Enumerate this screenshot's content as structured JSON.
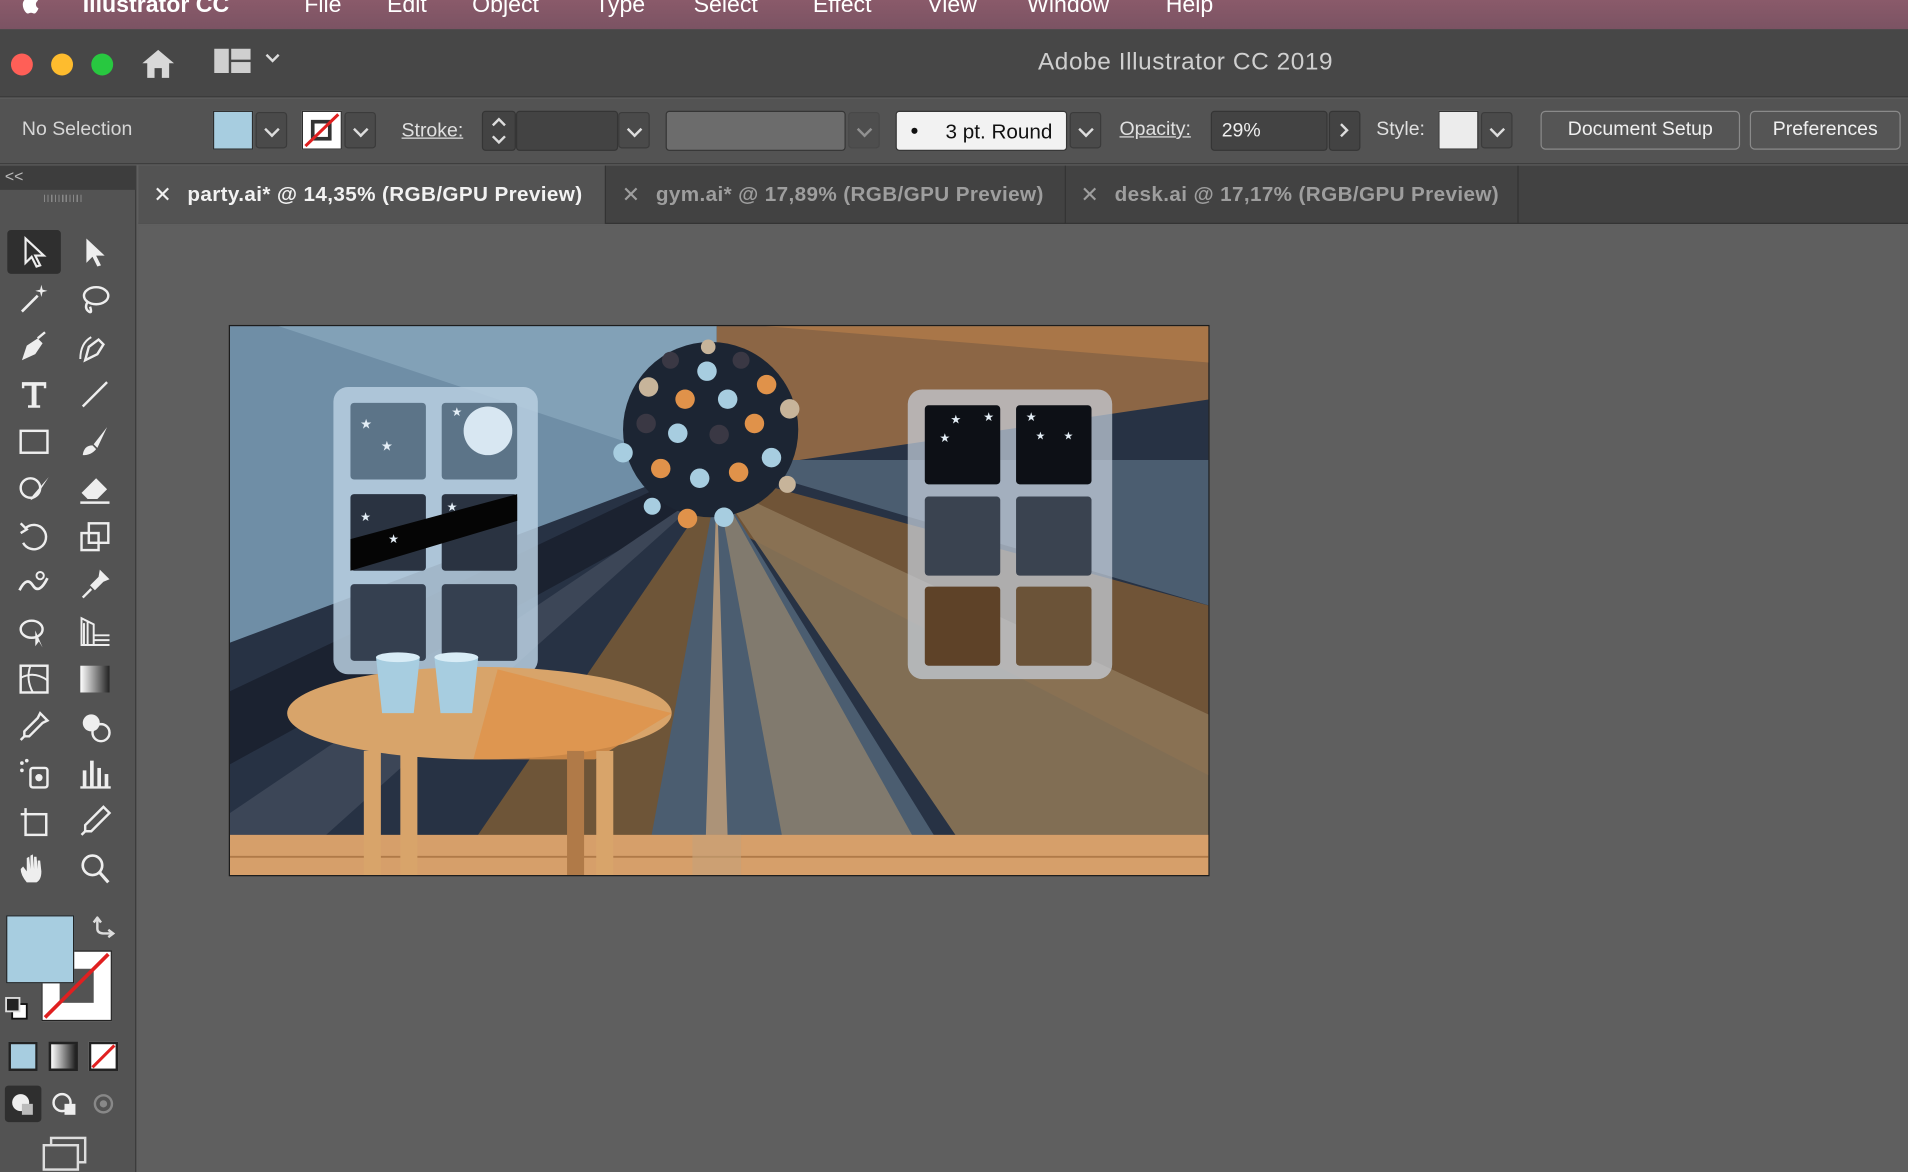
{
  "menubar": {
    "app_name": "Illustrator CC",
    "items": [
      "File",
      "Edit",
      "Object",
      "Type",
      "Select",
      "Effect",
      "View",
      "Window",
      "Help"
    ]
  },
  "window": {
    "title": "Adobe Illustrator CC 2019"
  },
  "control_bar": {
    "selection_label": "No Selection",
    "stroke_label": "Stroke:",
    "brush_label": "3 pt. Round",
    "opacity_label": "Opacity:",
    "opacity_value": "29%",
    "style_label": "Style:",
    "document_setup": "Document Setup",
    "preferences": "Preferences",
    "fill_color": "#a7cde0"
  },
  "tabs": [
    {
      "label": "party.ai* @ 14,35% (RGB/GPU Preview)",
      "active": true
    },
    {
      "label": "gym.ai* @ 17,89% (RGB/GPU Preview)",
      "active": false
    },
    {
      "label": "desk.ai @ 17,17% (RGB/GPU Preview)",
      "active": false
    }
  ],
  "toolbar": {
    "collapse_glyph": "<<",
    "tools": [
      "selection-tool-icon",
      "direct-selection-tool-icon",
      "magic-wand-tool-icon",
      "lasso-tool-icon",
      "pen-tool-icon",
      "curvature-tool-icon",
      "type-tool-icon",
      "line-segment-tool-icon",
      "rectangle-tool-icon",
      "paintbrush-tool-icon",
      "shaper-tool-icon",
      "eraser-tool-icon",
      "rotate-tool-icon",
      "scale-tool-icon",
      "warp-tool-icon",
      "puppet-warp-tool-icon",
      "free-transform-tool-icon",
      "perspective-grid-tool-icon",
      "mesh-tool-icon",
      "gradient-tool-icon",
      "eyedropper-tool-icon",
      "shape-builder-tool-icon",
      "symbol-sprayer-tool-icon",
      "column-graph-tool-icon",
      "artboard-tool-icon",
      "slice-tool-icon",
      "hand-tool-icon",
      "zoom-tool-icon"
    ]
  },
  "colors": {
    "fill": "#a7cde0",
    "stroke_none_line": "#e02020",
    "accent_orange": "#e0924a",
    "night_blue": "#1c2533"
  }
}
